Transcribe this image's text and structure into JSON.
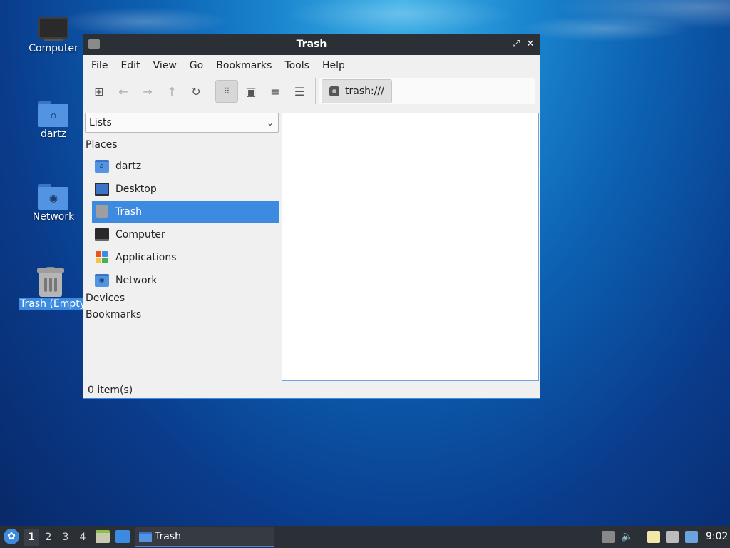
{
  "desktop": {
    "icons": [
      {
        "label": "Computer",
        "icon": "computer-icon"
      },
      {
        "label": "dartz",
        "icon": "home-folder-icon"
      },
      {
        "label": "Network",
        "icon": "network-folder-icon"
      },
      {
        "label": "Trash (Empty)",
        "icon": "trash-icon",
        "selected": true
      }
    ]
  },
  "window": {
    "title": "Trash",
    "controls": {
      "minimize": "–",
      "maximize": "⤢",
      "close": "✕"
    },
    "menu": [
      "File",
      "Edit",
      "View",
      "Go",
      "Bookmarks",
      "Tools",
      "Help"
    ],
    "toolbar": {
      "new_tab": "new-tab-icon",
      "back": "arrow-left-icon",
      "forward": "arrow-right-icon",
      "up": "arrow-up-icon",
      "reload": "reload-icon",
      "view_modes": [
        "icon-view",
        "thumbnail-view",
        "compact-view",
        "detailed-list-view"
      ],
      "active_view": "icon-view"
    },
    "path": "trash:///",
    "sidebar": {
      "mode": "Lists",
      "sections": {
        "places": "Places",
        "devices": "Devices",
        "bookmarks": "Bookmarks"
      },
      "places": [
        {
          "label": "dartz",
          "icon": "home-folder-icon"
        },
        {
          "label": "Desktop",
          "icon": "desktop-icon"
        },
        {
          "label": "Trash",
          "icon": "trash-icon",
          "selected": true
        },
        {
          "label": "Computer",
          "icon": "computer-icon"
        },
        {
          "label": "Applications",
          "icon": "applications-icon"
        },
        {
          "label": "Network",
          "icon": "network-folder-icon"
        }
      ]
    },
    "status": "0 item(s)"
  },
  "taskbar": {
    "workspaces": [
      "1",
      "2",
      "3",
      "4"
    ],
    "current_workspace": "1",
    "task_label": "Trash",
    "clock": "9:02"
  },
  "colors": {
    "accent": "#3d8be0",
    "titlebar": "#2b2f36",
    "folder": "#5294e2"
  }
}
